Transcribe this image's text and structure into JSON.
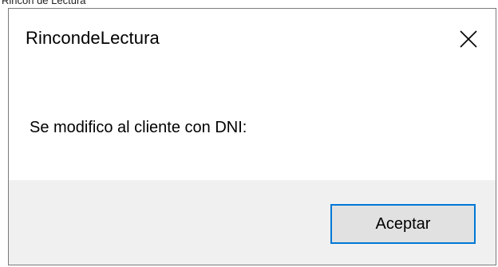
{
  "background": {
    "fragment_text": "Rincon de Lectura"
  },
  "dialog": {
    "title": "RincondeLectura",
    "close_icon": "close-icon",
    "message": "Se modifico al cliente con DNI:",
    "accept_label": "Aceptar"
  },
  "colors": {
    "accent_border": "#0078d7",
    "footer_bg": "#f0f0f0",
    "button_bg": "#e1e1e1"
  }
}
